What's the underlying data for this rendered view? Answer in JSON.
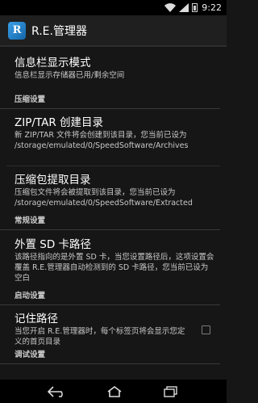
{
  "status_bar": {
    "time": "9:22",
    "icons": [
      "wifi-icon",
      "signal-icon",
      "battery-icon"
    ]
  },
  "action_bar": {
    "app_title": "R.E.管理器",
    "app_icon_letter": "R"
  },
  "prefs": {
    "statusbar_mode": {
      "title": "信息栏显示模式",
      "summary": "信息栏显示存储器已用/剩余空间"
    },
    "cat_compress": "压缩设置",
    "zip_dir": {
      "title": "ZIP/TAR 创建目录",
      "summary": "新 ZIP/TAR 文件将会创建到该目录，您当前已设为 /storage/emulated/0/SpeedSoftware/Archives"
    },
    "extract_dir": {
      "title": "压缩包提取目录",
      "summary": "压缩包文件将会被提取到该目录，您当前已设为 /storage/emulated/0/SpeedSoftware/Extracted"
    },
    "cat_general": "常规设置",
    "sd_path": {
      "title": "外置 SD 卡路径",
      "summary": "该路径指向的是外置 SD 卡，当您设置路径后，这项设置会覆盖 R.E.管理器自动检测到的 SD 卡路径，您当前已设为 空白"
    },
    "cat_startup": "启动设置",
    "remember_path": {
      "title": "记住路径",
      "summary": "当您开启 R.E.管理器时，每个标签页将会显示您定义的首页目录",
      "checked": false
    },
    "cat_debug": "调试设置"
  },
  "nav_bar": {
    "icons": [
      "back-icon",
      "home-icon",
      "recents-icon"
    ]
  },
  "colors": {
    "background": "#161616",
    "action_bar": "#1f1f1f",
    "accent": "#3aa0e8"
  }
}
